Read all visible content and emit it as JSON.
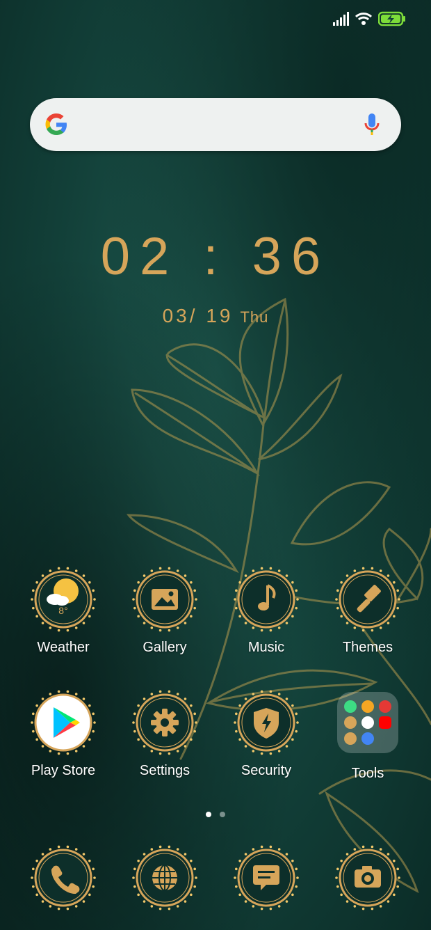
{
  "status_bar": {
    "signal_icon": "signal-bars-icon",
    "wifi_icon": "wifi-icon",
    "battery_icon": "battery-charging-icon"
  },
  "search": {
    "logo_icon": "google-g-icon",
    "mic_icon": "microphone-icon"
  },
  "clock": {
    "time": "02 : 36",
    "date": "03/ 19",
    "weekday": "Thu"
  },
  "apps_row1": [
    {
      "label": "Weather",
      "icon": "weather-sun-cloud-icon",
      "temp": "8°"
    },
    {
      "label": "Gallery",
      "icon": "gallery-image-icon"
    },
    {
      "label": "Music",
      "icon": "music-note-icon"
    },
    {
      "label": "Themes",
      "icon": "paintbrush-icon"
    }
  ],
  "apps_row2": [
    {
      "label": "Play Store",
      "icon": "play-store-icon"
    },
    {
      "label": "Settings",
      "icon": "gear-icon"
    },
    {
      "label": "Security",
      "icon": "shield-bolt-icon"
    },
    {
      "label": "Tools",
      "icon": "folder-icon"
    }
  ],
  "dock": [
    {
      "name": "phone",
      "icon": "phone-icon"
    },
    {
      "name": "browser",
      "icon": "globe-icon"
    },
    {
      "name": "messages",
      "icon": "message-icon"
    },
    {
      "name": "camera",
      "icon": "camera-icon"
    }
  ],
  "page_indicator": {
    "pages": 2,
    "current": 1
  },
  "colors": {
    "gold": "#d6a55a",
    "background": "#123f38",
    "medal_fill": "#0d2f2a"
  }
}
